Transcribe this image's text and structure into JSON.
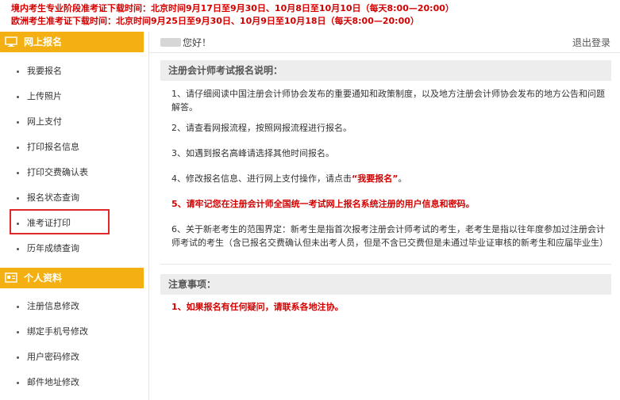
{
  "notices": [
    "境内考生专业阶段准考证下载时间：北京时间9月17日至9月30日、10月8日至10月10日（每天8:00—20:00）",
    "欧洲考生准考证下载时间：北京时间9月25日至9月30日、10月9日至10月18日（每天8:00—20:00）"
  ],
  "sidebar": {
    "sections": [
      {
        "title": "网上报名",
        "icon": "monitor-icon",
        "items": [
          "我要报名",
          "上传照片",
          "网上支付",
          "打印报名信息",
          "打印交费确认表",
          "报名状态查询",
          "准考证打印",
          "历年成绩查询"
        ]
      },
      {
        "title": "个人资料",
        "icon": "profile-card-icon",
        "items": [
          "注册信息修改",
          "绑定手机号修改",
          "用户密码修改",
          "邮件地址修改"
        ]
      }
    ],
    "highlighted_item": "准考证打印",
    "header_color": "#f4b012",
    "highlight_color": "#e0282a"
  },
  "topbar": {
    "greeting": "您好！",
    "logout": "退出登录"
  },
  "instructions": {
    "title": "注册会计师考试报名说明：",
    "items": [
      "1、请仔细阅读中国注册会计师协会发布的重要通知和政策制度，以及地方注册会计师协会发布的地方公告和问题解答。",
      "2、请查看网报流程，按照网报流程进行报名。",
      "3、如遇到报名高峰请选择其他时间报名。",
      "4、修改报名信息、进行网上支付操作，请点击",
      "5、请牢记您在注册会计师全国统一考试网上报名系统注册的用户信息和密码。",
      "6、关于新老考生的范围界定：新考生是指首次报考注册会计师考试的考生，老考生是指以往年度参加过注册会计师考试的考生（含已报名交费确认但未出考人员，但是不含已交费但是未通过毕业证审核的新考生和应届毕业生）"
    ],
    "item4_link": "“我要报名”",
    "item4_end": "。"
  },
  "notes": {
    "title": "注意事项：",
    "items": [
      "1、如果报名有任何疑问，请联系各地注协。"
    ]
  },
  "colors": {
    "alert_red": "#d40000",
    "accent": "#f4b012"
  }
}
